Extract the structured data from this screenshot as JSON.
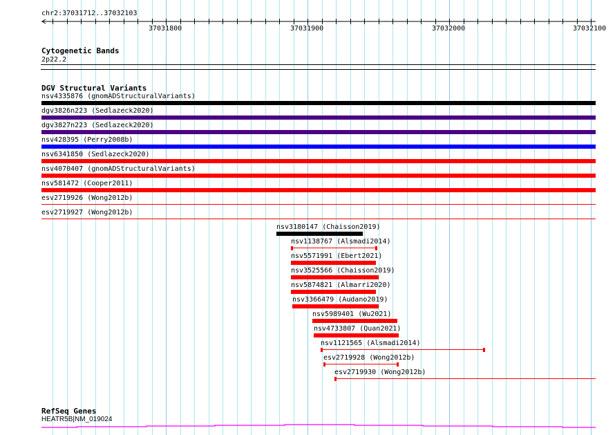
{
  "view": {
    "chrom": "chr2",
    "start": 37031712,
    "end": 37032103,
    "location_label": "chr2:37031712..37032103"
  },
  "ruler": {
    "ticks": [
      "37031800",
      "37031900",
      "37032000",
      "37032100"
    ]
  },
  "colors": {
    "grid_minor": "#a8e6ee",
    "grid_major": "#8cc8ee",
    "black": "#000000",
    "purple": "#4b0082",
    "blue": "#0000ff",
    "red": "#ff0000",
    "gene": "#ff00ff"
  },
  "cytobands": {
    "title": "Cytogenetic Bands",
    "band": "2p22.2"
  },
  "dgv": {
    "title": "DGV Structural Variants",
    "full_rows": [
      {
        "label": "nsv4335876 (gnomADStructuralVariants)",
        "color": "black",
        "style": "thick"
      },
      {
        "label": "dgv3826n223 (Sedlazeck2020)",
        "color": "purple",
        "style": "thick"
      },
      {
        "label": "dgv3827n223 (Sedlazeck2020)",
        "color": "purple",
        "style": "thick"
      },
      {
        "label": "nsv428395 (Perry2008b)",
        "color": "blue",
        "style": "thick"
      },
      {
        "label": "nsv6341850 (Sedlazeck2020)",
        "color": "red",
        "style": "thick"
      },
      {
        "label": "nsv4070407 (gnomADStructuralVariants)",
        "color": "red",
        "style": "thick"
      },
      {
        "label": "nsv581472 (Cooper2011)",
        "color": "red",
        "style": "thick"
      },
      {
        "label": "esv2719926 (Wong2012b)",
        "color": "red",
        "style": "thin"
      },
      {
        "label": "esv2719927 (Wong2012b)",
        "color": "red",
        "style": "thin"
      }
    ],
    "features": [
      {
        "label": "nsv3180147 (Chaisson2019)",
        "start": 37031878,
        "end": 37031939,
        "color": "black",
        "style": "thick"
      },
      {
        "label": "nsv1138767 (Alsmadi2014)",
        "start": 37031888,
        "end": 37031949,
        "color": "red",
        "style": "capped"
      },
      {
        "label": "nsv5571991 (Ebert2021)",
        "start": 37031888,
        "end": 37031948,
        "color": "red",
        "style": "thick"
      },
      {
        "label": "nsv3525566 (Chaisson2019)",
        "start": 37031888,
        "end": 37031950,
        "color": "red",
        "style": "thick"
      },
      {
        "label": "nsv5874821 (Almarri2020)",
        "start": 37031888,
        "end": 37031948,
        "color": "red",
        "style": "thick"
      },
      {
        "label": "nsv3366479 (Audano2019)",
        "start": 37031889,
        "end": 37031950,
        "color": "red",
        "style": "thick"
      },
      {
        "label": "nsv5989401 (Wu2021)",
        "start": 37031903,
        "end": 37031963,
        "color": "red",
        "style": "thick"
      },
      {
        "label": "nsv4733807 (Quan2021)",
        "start": 37031904,
        "end": 37031964,
        "color": "red",
        "style": "thick"
      },
      {
        "label": "nsv1121565 (Alsmadi2014)",
        "start": 37031909,
        "end": 37032025,
        "color": "red",
        "style": "capped"
      },
      {
        "label": "esv2719928 (Wong2012b)",
        "start": 37031911,
        "end": 37031964,
        "color": "red",
        "style": "capped"
      },
      {
        "label": "esv2719930 (Wong2012b)",
        "start": 37031919,
        "end": 37032103,
        "color": "red",
        "style": "leftcap"
      }
    ]
  },
  "refseq": {
    "title": "RefSeq Genes",
    "gene": "HEATR5B|NM_019024"
  }
}
